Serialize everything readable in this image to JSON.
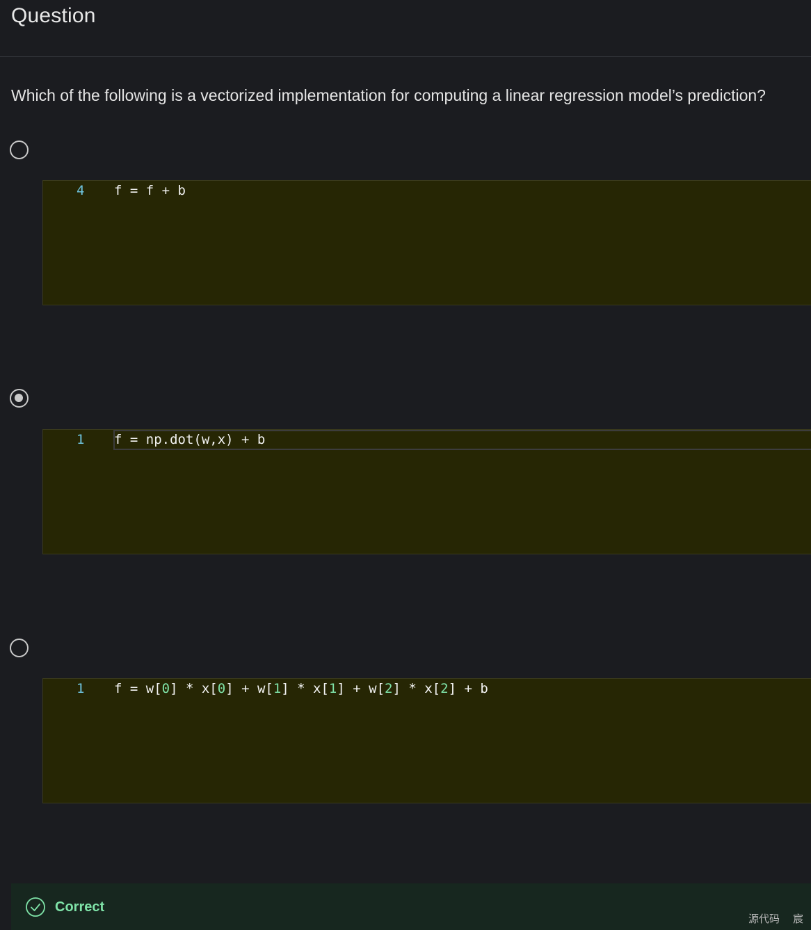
{
  "header": {
    "title": "Question"
  },
  "question": {
    "text": "Which of the following is a vectorized implementation for computing a linear regression model’s prediction?"
  },
  "options": [
    {
      "selected": false,
      "line_number": "4",
      "code_parts": [
        {
          "t": "f = f + b",
          "k": "plain"
        }
      ]
    },
    {
      "selected": true,
      "line_number": "1",
      "code_parts": [
        {
          "t": "f = np.dot(w,x) + b",
          "k": "plain"
        }
      ]
    },
    {
      "selected": false,
      "line_number": "1",
      "code_parts": [
        {
          "t": "f = w[",
          "k": "plain"
        },
        {
          "t": "0",
          "k": "num"
        },
        {
          "t": "] * x[",
          "k": "plain"
        },
        {
          "t": "0",
          "k": "num"
        },
        {
          "t": "] + w[",
          "k": "plain"
        },
        {
          "t": "1",
          "k": "num"
        },
        {
          "t": "] * x[",
          "k": "plain"
        },
        {
          "t": "1",
          "k": "num"
        },
        {
          "t": "] + w[",
          "k": "plain"
        },
        {
          "t": "2",
          "k": "num"
        },
        {
          "t": "] * x[",
          "k": "plain"
        },
        {
          "t": "2",
          "k": "num"
        },
        {
          "t": "] + b",
          "k": "plain"
        }
      ]
    }
  ],
  "result": {
    "label": "Correct",
    "icon": "check-circle-icon",
    "color": "#7fe3a8"
  },
  "footer": {
    "left": "源代码",
    "right": "宸"
  },
  "colors": {
    "background": "#1b1c20",
    "code_background": "#262604",
    "line_number": "#6fc3de",
    "number_literal": "#7fe3a8"
  }
}
